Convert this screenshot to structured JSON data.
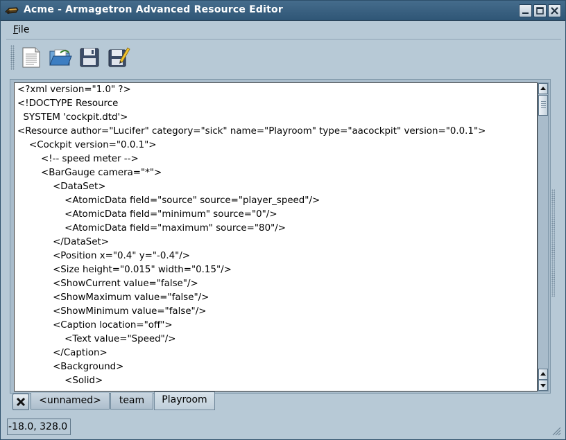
{
  "window": {
    "title": "Acme - Armagetron Advanced Resource Editor",
    "app_icon": "acme-tron-icon",
    "buttons": [
      "minimize",
      "maximize",
      "close"
    ]
  },
  "menu": {
    "file_first": "F",
    "file_rest": "ile"
  },
  "toolbar": {
    "items": [
      {
        "name": "new-document-icon",
        "tooltip": ""
      },
      {
        "name": "open-folder-icon",
        "tooltip": ""
      },
      {
        "name": "save-disk-icon",
        "tooltip": ""
      },
      {
        "name": "save-as-icon",
        "tooltip": ""
      }
    ]
  },
  "editor": {
    "lines": [
      "<?xml version=\"1.0\" ?>",
      "<!DOCTYPE Resource",
      "  SYSTEM 'cockpit.dtd'>",
      "<Resource author=\"Lucifer\" category=\"sick\" name=\"Playroom\" type=\"aacockpit\" version=\"0.0.1\">",
      "    <Cockpit version=\"0.0.1\">",
      "        <!-- speed meter -->",
      "        <BarGauge camera=\"*\">",
      "            <DataSet>",
      "                <AtomicData field=\"source\" source=\"player_speed\"/>",
      "                <AtomicData field=\"minimum\" source=\"0\"/>",
      "                <AtomicData field=\"maximum\" source=\"80\"/>",
      "            </DataSet>",
      "            <Position x=\"0.4\" y=\"-0.4\"/>",
      "            <Size height=\"0.015\" width=\"0.15\"/>",
      "            <ShowCurrent value=\"false\"/>",
      "            <ShowMaximum value=\"false\"/>",
      "            <ShowMinimum value=\"false\"/>",
      "            <Caption location=\"off\">",
      "                <Text value=\"Speed\"/>",
      "            </Caption>",
      "            <Background>",
      "                <Solid>"
    ]
  },
  "tabs": [
    {
      "label": "<unnamed>",
      "active": false
    },
    {
      "label": "team",
      "active": false
    },
    {
      "label": "Playroom",
      "active": true
    }
  ],
  "status": {
    "coords": "-18.0, 328.0"
  },
  "colors": {
    "titlebar": "#2f5676",
    "window_bg": "#b7c9d6",
    "desktop": "#5f8fae"
  }
}
